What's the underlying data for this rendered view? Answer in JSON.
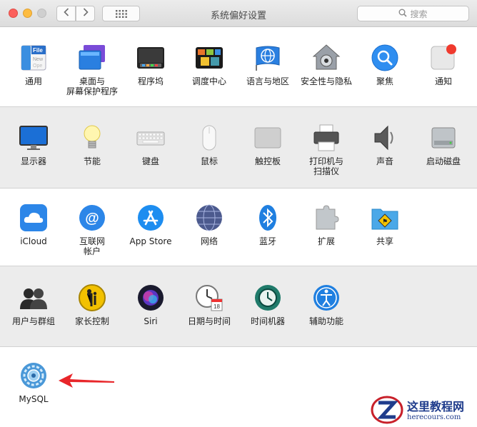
{
  "window": {
    "title": "系统偏好设置",
    "search_placeholder": "搜索",
    "back_icon": "chevron-left-icon",
    "forward_icon": "chevron-right-icon",
    "grid_icon": "grid-icon"
  },
  "sections": [
    {
      "panes": [
        {
          "label": "通用",
          "icon": "general-icon"
        },
        {
          "label": "桌面与\n屏幕保护程序",
          "icon": "desktop-screensaver-icon"
        },
        {
          "label": "程序坞",
          "icon": "dock-icon"
        },
        {
          "label": "调度中心",
          "icon": "mission-control-icon"
        },
        {
          "label": "语言与地区",
          "icon": "language-region-icon"
        },
        {
          "label": "安全性与隐私",
          "icon": "security-privacy-icon"
        },
        {
          "label": "聚焦",
          "icon": "spotlight-icon"
        },
        {
          "label": "通知",
          "icon": "notifications-icon"
        }
      ]
    },
    {
      "panes": [
        {
          "label": "显示器",
          "icon": "displays-icon"
        },
        {
          "label": "节能",
          "icon": "energy-saver-icon"
        },
        {
          "label": "键盘",
          "icon": "keyboard-icon"
        },
        {
          "label": "鼠标",
          "icon": "mouse-icon"
        },
        {
          "label": "触控板",
          "icon": "trackpad-icon"
        },
        {
          "label": "打印机与\n扫描仪",
          "icon": "printers-scanners-icon"
        },
        {
          "label": "声音",
          "icon": "sound-icon"
        },
        {
          "label": "启动磁盘",
          "icon": "startup-disk-icon"
        }
      ]
    },
    {
      "panes": [
        {
          "label": "iCloud",
          "icon": "icloud-icon"
        },
        {
          "label": "互联网\n帐户",
          "icon": "internet-accounts-icon"
        },
        {
          "label": "App Store",
          "icon": "app-store-icon"
        },
        {
          "label": "网络",
          "icon": "network-icon"
        },
        {
          "label": "蓝牙",
          "icon": "bluetooth-icon"
        },
        {
          "label": "扩展",
          "icon": "extensions-icon"
        },
        {
          "label": "共享",
          "icon": "sharing-icon"
        }
      ]
    },
    {
      "panes": [
        {
          "label": "用户与群组",
          "icon": "users-groups-icon"
        },
        {
          "label": "家长控制",
          "icon": "parental-controls-icon"
        },
        {
          "label": "Siri",
          "icon": "siri-icon"
        },
        {
          "label": "日期与时间",
          "icon": "date-time-icon"
        },
        {
          "label": "时间机器",
          "icon": "time-machine-icon"
        },
        {
          "label": "辅助功能",
          "icon": "accessibility-icon"
        }
      ]
    },
    {
      "panes": [
        {
          "label": "MySQL",
          "icon": "mysql-icon"
        }
      ]
    }
  ],
  "annotation": {
    "icon": "red-arrow-icon",
    "color": "#e8262a"
  },
  "watermark": {
    "cn": "这里教程网",
    "url": "herecours.com",
    "icon": "z-logo-icon"
  }
}
